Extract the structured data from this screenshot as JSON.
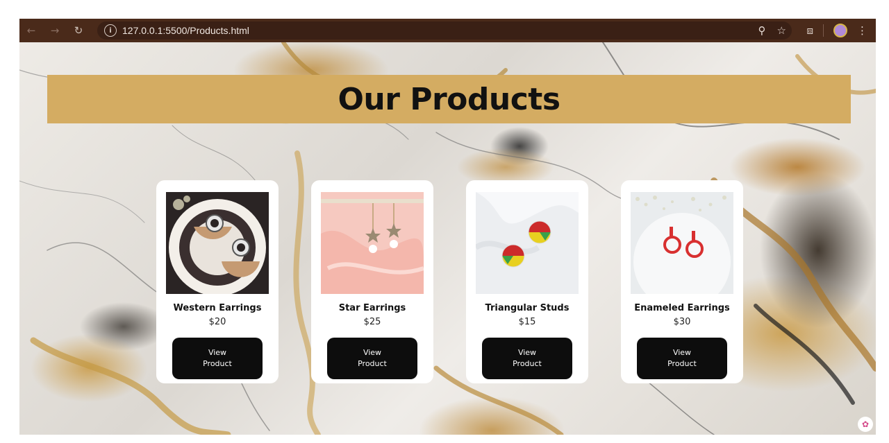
{
  "browser": {
    "url": "127.0.0.1:5500/Products.html",
    "nav_icons": [
      "back-arrow-icon",
      "forward-arrow-icon",
      "reload-icon"
    ],
    "toolbar_icons": [
      "zoom-icon",
      "bookmark-star-icon",
      "extensions-icon",
      "profile-avatar",
      "menu-dots-icon"
    ]
  },
  "page": {
    "title": "Our Products",
    "banner_color": "#d4ac62"
  },
  "products": [
    {
      "name": "Western Earrings",
      "price": "$20",
      "button_line1": "View",
      "button_line2": "Product"
    },
    {
      "name": "Star Earrings",
      "price": "$25",
      "button_line1": "View",
      "button_line2": "Product"
    },
    {
      "name": "Triangular Studs",
      "price": "$15",
      "button_line1": "View",
      "button_line2": "Product"
    },
    {
      "name": "Enameled Earrings",
      "price": "$30",
      "button_line1": "View",
      "button_line2": "Product"
    }
  ]
}
